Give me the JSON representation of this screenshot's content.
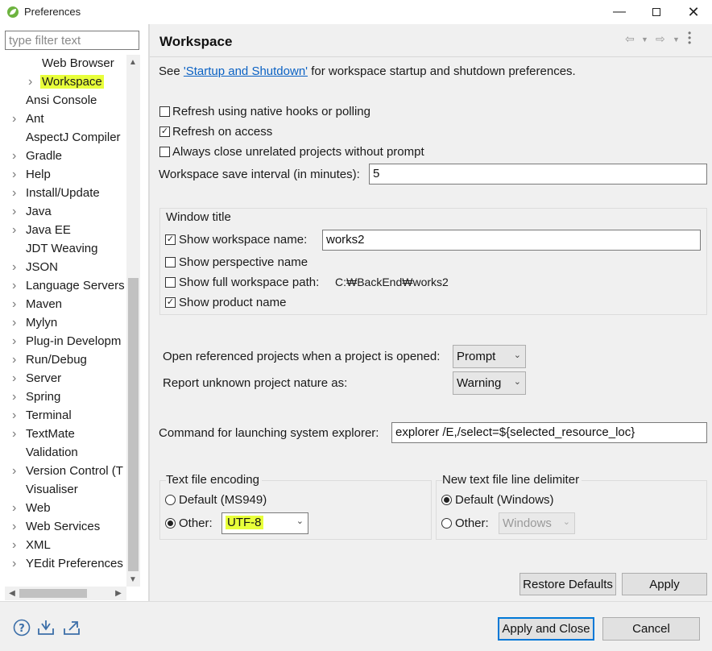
{
  "window": {
    "title": "Preferences",
    "icon": "spring-leaf-icon"
  },
  "filter": {
    "placeholder": "type filter text",
    "value": ""
  },
  "tree": {
    "items": [
      {
        "label": "Web Browser",
        "expandable": false,
        "indent": 1
      },
      {
        "label": "Workspace",
        "expandable": true,
        "indent": 1,
        "selected": true
      },
      {
        "label": "Ansi Console",
        "expandable": false,
        "indent": 0
      },
      {
        "label": "Ant",
        "expandable": true,
        "indent": 0
      },
      {
        "label": "AspectJ Compiler",
        "expandable": false,
        "indent": 0
      },
      {
        "label": "Gradle",
        "expandable": true,
        "indent": 0
      },
      {
        "label": "Help",
        "expandable": true,
        "indent": 0
      },
      {
        "label": "Install/Update",
        "expandable": true,
        "indent": 0
      },
      {
        "label": "Java",
        "expandable": true,
        "indent": 0
      },
      {
        "label": "Java EE",
        "expandable": true,
        "indent": 0
      },
      {
        "label": "JDT Weaving",
        "expandable": false,
        "indent": 0
      },
      {
        "label": "JSON",
        "expandable": true,
        "indent": 0
      },
      {
        "label": "Language Servers",
        "expandable": true,
        "indent": 0
      },
      {
        "label": "Maven",
        "expandable": true,
        "indent": 0
      },
      {
        "label": "Mylyn",
        "expandable": true,
        "indent": 0
      },
      {
        "label": "Plug-in Developm",
        "expandable": true,
        "indent": 0
      },
      {
        "label": "Run/Debug",
        "expandable": true,
        "indent": 0
      },
      {
        "label": "Server",
        "expandable": true,
        "indent": 0
      },
      {
        "label": "Spring",
        "expandable": true,
        "indent": 0
      },
      {
        "label": "Terminal",
        "expandable": true,
        "indent": 0
      },
      {
        "label": "TextMate",
        "expandable": true,
        "indent": 0
      },
      {
        "label": "Validation",
        "expandable": false,
        "indent": 0
      },
      {
        "label": "Version Control (T",
        "expandable": true,
        "indent": 0
      },
      {
        "label": "Visualiser",
        "expandable": false,
        "indent": 0
      },
      {
        "label": "Web",
        "expandable": true,
        "indent": 0
      },
      {
        "label": "Web Services",
        "expandable": true,
        "indent": 0
      },
      {
        "label": "XML",
        "expandable": true,
        "indent": 0
      },
      {
        "label": "YEdit Preferences",
        "expandable": true,
        "indent": 0
      }
    ]
  },
  "page": {
    "title": "Workspace",
    "intro_prefix": "See ",
    "intro_link": "'Startup and Shutdown'",
    "intro_suffix": " for workspace startup and shutdown preferences.",
    "refresh_native": {
      "label": "Refresh using native hooks or polling",
      "checked": false
    },
    "refresh_access": {
      "label": "Refresh on access",
      "checked": true
    },
    "always_close": {
      "label": "Always close unrelated projects without prompt",
      "checked": false
    },
    "save_interval": {
      "label": "Workspace save interval (in minutes):",
      "value": "5"
    },
    "window_title": {
      "group_label": "Window title",
      "show_ws_name": {
        "label": "Show workspace name:",
        "checked": true,
        "value": "works2"
      },
      "show_perspective": {
        "label": "Show perspective name",
        "checked": false
      },
      "show_full_path": {
        "label": "Show full workspace path:",
        "checked": false,
        "value": "C:₩BackEnd₩works2"
      },
      "show_product": {
        "label": "Show product name",
        "checked": true
      }
    },
    "open_ref": {
      "label": "Open referenced projects when a project is opened:",
      "value": "Prompt"
    },
    "report_nature": {
      "label": "Report unknown project nature as:",
      "value": "Warning"
    },
    "explorer_cmd": {
      "label": "Command for launching system explorer:",
      "value": "explorer /E,/select=${selected_resource_loc}"
    },
    "encoding": {
      "group_label": "Text file encoding",
      "default_label": "Default (MS949)",
      "other_label": "Other:",
      "selected": "other",
      "other_value": "UTF-8"
    },
    "line_delim": {
      "group_label": "New text file line delimiter",
      "default_label": "Default (Windows)",
      "other_label": "Other:",
      "selected": "default",
      "other_value": "Windows"
    }
  },
  "buttons": {
    "restore_defaults": "Restore Defaults",
    "apply": "Apply",
    "apply_close": "Apply and Close",
    "cancel": "Cancel"
  },
  "colors": {
    "highlight": "#e8ff3a",
    "link": "#0b62c4",
    "default_border": "#0078d7"
  }
}
